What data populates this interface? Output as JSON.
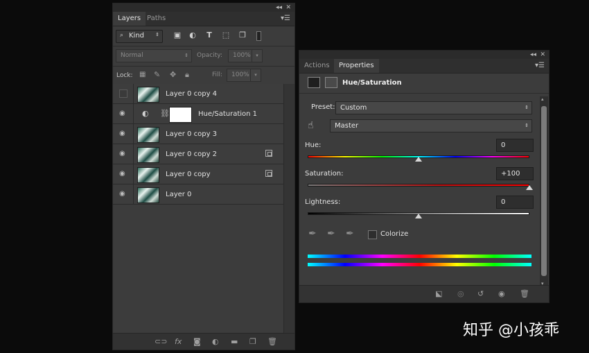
{
  "layers_panel": {
    "tabs": [
      "Layers",
      "Paths"
    ],
    "filter": {
      "kind_label": "Kind"
    },
    "blend_mode": "Normal",
    "opacity_label": "Opacity:",
    "opacity_value": "100%",
    "lock_label": "Lock:",
    "fill_label": "Fill:",
    "fill_value": "100%",
    "layers": [
      {
        "name": "Layer 0 copy 4",
        "visible": false,
        "type": "pixel"
      },
      {
        "name": "Hue/Saturation 1",
        "visible": true,
        "type": "adjustment"
      },
      {
        "name": "Layer 0 copy 3",
        "visible": true,
        "type": "pixel"
      },
      {
        "name": "Layer 0 copy 2",
        "visible": true,
        "type": "pixel",
        "linked_smart": true
      },
      {
        "name": "Layer 0 copy",
        "visible": true,
        "type": "pixel",
        "linked_smart": true
      },
      {
        "name": "Layer 0",
        "visible": true,
        "type": "pixel"
      }
    ],
    "bottom_icons": [
      "link-icon",
      "fx-icon",
      "mask-icon",
      "adjustment-icon",
      "folder-icon",
      "new-layer-icon",
      "trash-icon"
    ]
  },
  "properties_panel": {
    "tabs": [
      "Actions",
      "Properties"
    ],
    "title": "Hue/Saturation",
    "preset_label": "Preset:",
    "preset_value": "Custom",
    "channel_value": "Master",
    "hue_label": "Hue:",
    "hue_value": "0",
    "saturation_label": "Saturation:",
    "saturation_value": "+100",
    "lightness_label": "Lightness:",
    "lightness_value": "0",
    "colorize_label": "Colorize",
    "slider_levels": {
      "hue": 0.5,
      "saturation": 1.0,
      "lightness": 0.5
    }
  },
  "watermark": "知乎 @小孩乖",
  "colors": {
    "panel_bg": "#3c3c3c",
    "dark_bg": "#0b0b0b",
    "accent": "#ffffff"
  }
}
